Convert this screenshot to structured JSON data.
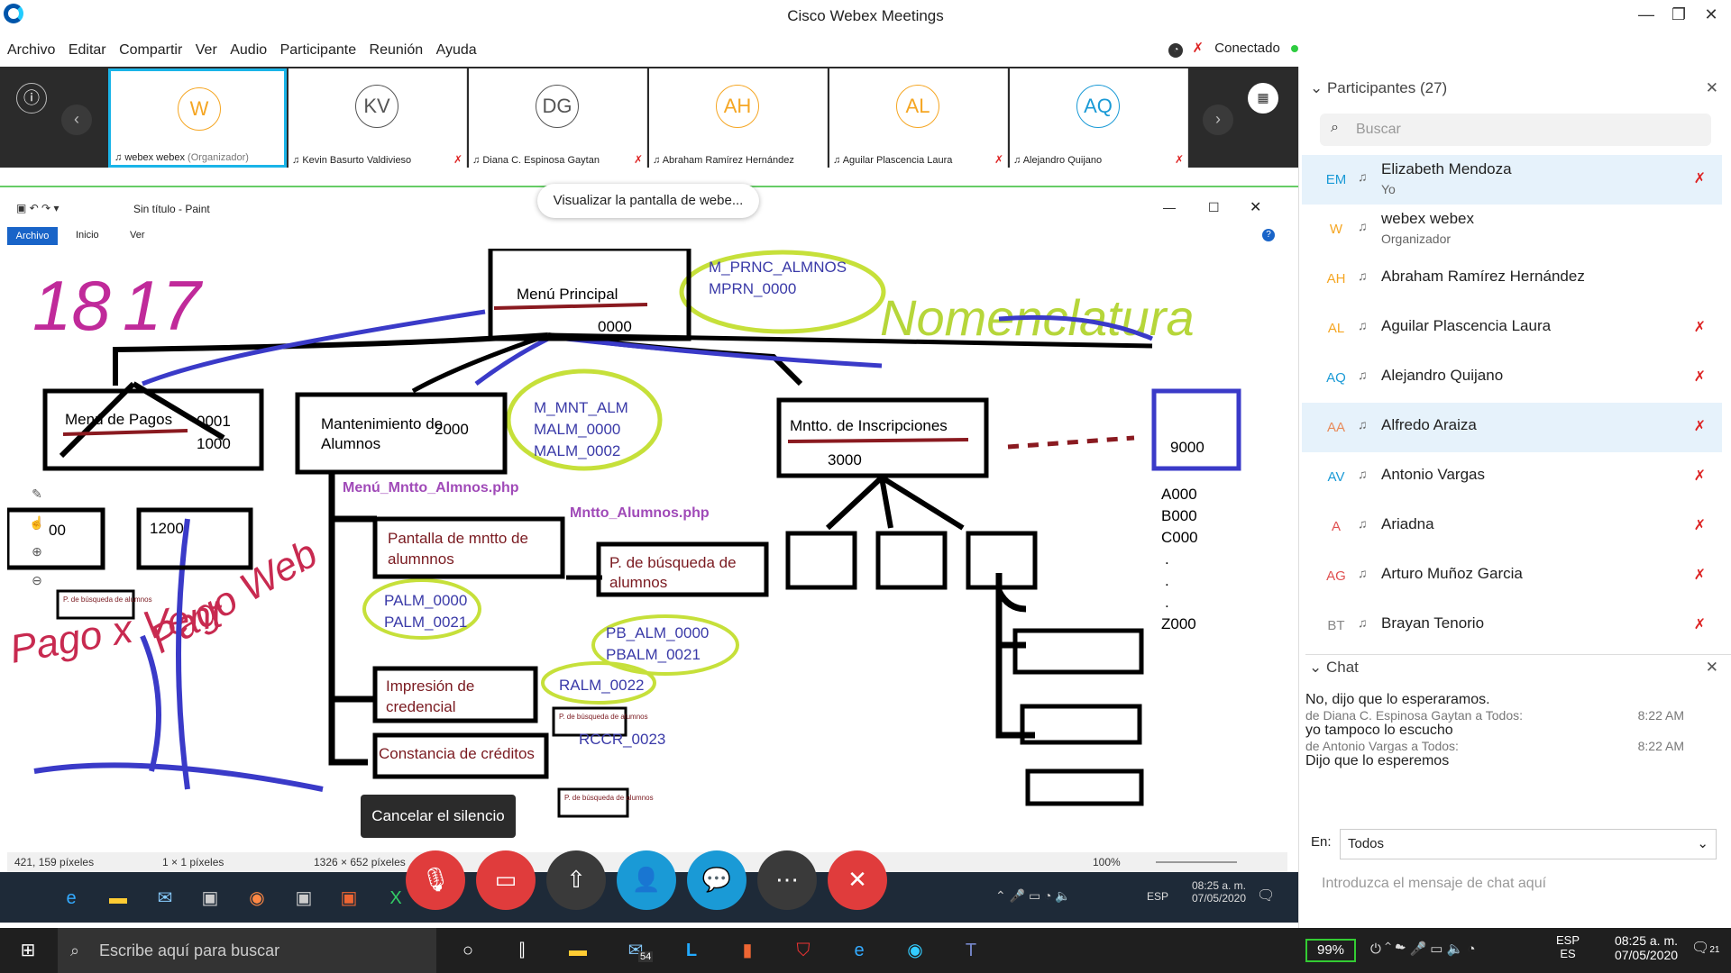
{
  "window": {
    "title": "Cisco Webex Meetings"
  },
  "menu": [
    "Archivo",
    "Editar",
    "Compartir",
    "Ver",
    "Audio",
    "Participante",
    "Reunión",
    "Ayuda"
  ],
  "connection": {
    "label": "Conectado",
    "status_color": "#2ecc40"
  },
  "strip": {
    "tiles": [
      {
        "initials": "W",
        "name": "webex webex",
        "role": "(Organizador)",
        "color": "#f5a623",
        "muted": false
      },
      {
        "initials": "KV",
        "name": "Kevin Basurto Valdivieso",
        "role": "",
        "color": "#555",
        "muted": true
      },
      {
        "initials": "DG",
        "name": "Diana C. Espinosa Gaytan",
        "role": "",
        "color": "#555",
        "muted": true
      },
      {
        "initials": "AH",
        "name": "Abraham Ramírez Hernández",
        "role": "",
        "color": "#f5a623",
        "muted": false
      },
      {
        "initials": "AL",
        "name": "Aguilar Plascencia Laura",
        "role": "",
        "color": "#f5a623",
        "muted": true
      },
      {
        "initials": "AQ",
        "name": "Alejandro Quijano",
        "role": "",
        "color": "#1a9ad6",
        "muted": true
      }
    ]
  },
  "share": {
    "viewing_label": "Visualizar la pantalla de webe...",
    "paint_title": "Sin título - Paint",
    "paint_tabs": [
      "Archivo",
      "Inicio",
      "Ver"
    ],
    "status_pos": "421, 159 píxeles",
    "status_sel": "1 × 1 píxeles",
    "status_size": "1326 × 652 píxeles",
    "zoom": "100%",
    "inner_lang": "ESP",
    "inner_time": "08:25 a. m.",
    "inner_date": "07/05/2020",
    "tooltip": "Cancelar el silencio"
  },
  "diagram": {
    "handwriting": [
      "18",
      "17",
      "Nomenclatura",
      "Pago x Vent",
      "Pago Web"
    ],
    "boxes": [
      {
        "label": "Menú Principal",
        "code": "0000"
      },
      {
        "label": "Menú de Pagos",
        "code": "0001\n1000"
      },
      {
        "label": "Mantenimiento de Alumnos",
        "code": "2000"
      },
      {
        "label": "Mntto. de Inscripciones",
        "code": "3000"
      },
      {
        "label": "",
        "code": "9000"
      },
      {
        "label": "Pantalla de mntto de alumnnos",
        "code": ""
      },
      {
        "label": "P. de búsqueda de alumnos",
        "code": ""
      },
      {
        "label": "Impresión de credencial",
        "code": ""
      },
      {
        "label": "Constancia de créditos",
        "code": ""
      },
      {
        "label": "",
        "code": "1200"
      },
      {
        "label": "",
        "code": "00"
      }
    ],
    "codes_main": "M_PRNC_ALMNOS\nMPRN_0000",
    "codes_mntto": "M_MNT_ALM\nMALM_0000\nMALM_0002",
    "php_menu": "Menú_Mntto_Almnos.php",
    "php_mntto": "Mntto_Alumnos.php",
    "codes_palm": "PALM_0000\nPALM_0021",
    "codes_pb": "PB_ALM_0000\nPBALM_0021",
    "code_ralm": "RALM_0022",
    "code_rccr": "RCCR_0023",
    "small_box": "P. de búsqueda de alumnos",
    "list_9000": [
      "A000",
      "B000",
      "C000",
      ".",
      ".",
      ".",
      "Z000"
    ]
  },
  "participants": {
    "header": "Participantes (27)",
    "search_placeholder": "Buscar",
    "list": [
      {
        "initials": "EM",
        "name": "Elizabeth Mendoza",
        "sub": "Yo",
        "muted": true,
        "selected": true,
        "color": "#1a9ad6"
      },
      {
        "initials": "W",
        "name": "webex webex",
        "sub": "Organizador",
        "muted": false,
        "selected": false,
        "color": "#f5a623"
      },
      {
        "initials": "AH",
        "name": "Abraham Ramírez Hernández",
        "sub": "",
        "muted": false,
        "selected": false,
        "color": "#f5a623"
      },
      {
        "initials": "AL",
        "name": "Aguilar Plascencia Laura",
        "sub": "",
        "muted": true,
        "selected": false,
        "color": "#f5a623"
      },
      {
        "initials": "AQ",
        "name": "Alejandro Quijano",
        "sub": "",
        "muted": true,
        "selected": false,
        "color": "#1a9ad6"
      },
      {
        "initials": "AA",
        "name": "Alfredo Araiza",
        "sub": "",
        "muted": true,
        "selected": true,
        "color": "#e88a5a"
      },
      {
        "initials": "AV",
        "name": "Antonio Vargas",
        "sub": "",
        "muted": true,
        "selected": false,
        "color": "#1a9ad6"
      },
      {
        "initials": "A",
        "name": "Ariadna",
        "sub": "",
        "muted": true,
        "selected": false,
        "color": "#e05050"
      },
      {
        "initials": "AG",
        "name": "Arturo Muñoz Garcia",
        "sub": "",
        "muted": true,
        "selected": false,
        "color": "#e05050"
      },
      {
        "initials": "BT",
        "name": "Brayan Tenorio",
        "sub": "",
        "muted": true,
        "selected": false,
        "color": "#888"
      }
    ]
  },
  "chat": {
    "header": "Chat",
    "messages": [
      {
        "text": "No, dijo que lo esperaramos.",
        "meta": "",
        "time": ""
      },
      {
        "text": "yo tampoco lo escucho",
        "meta": "de Diana C. Espinosa Gaytan a Todos:",
        "time": "8:22 AM"
      },
      {
        "text": "Dijo que lo esperemos",
        "meta": "de Antonio Vargas a Todos:",
        "time": "8:22 AM"
      }
    ],
    "to_label": "En:",
    "to_value": "Todos",
    "input_placeholder": "Introduzca el mensaje de chat aquí"
  },
  "taskbar": {
    "search": "Escribe aquí para buscar",
    "mail_badge": "54",
    "battery": "99%",
    "lang1": "ESP",
    "lang2": "ES",
    "time": "08:25 a. m.",
    "date": "07/05/2020",
    "notif": "21"
  }
}
